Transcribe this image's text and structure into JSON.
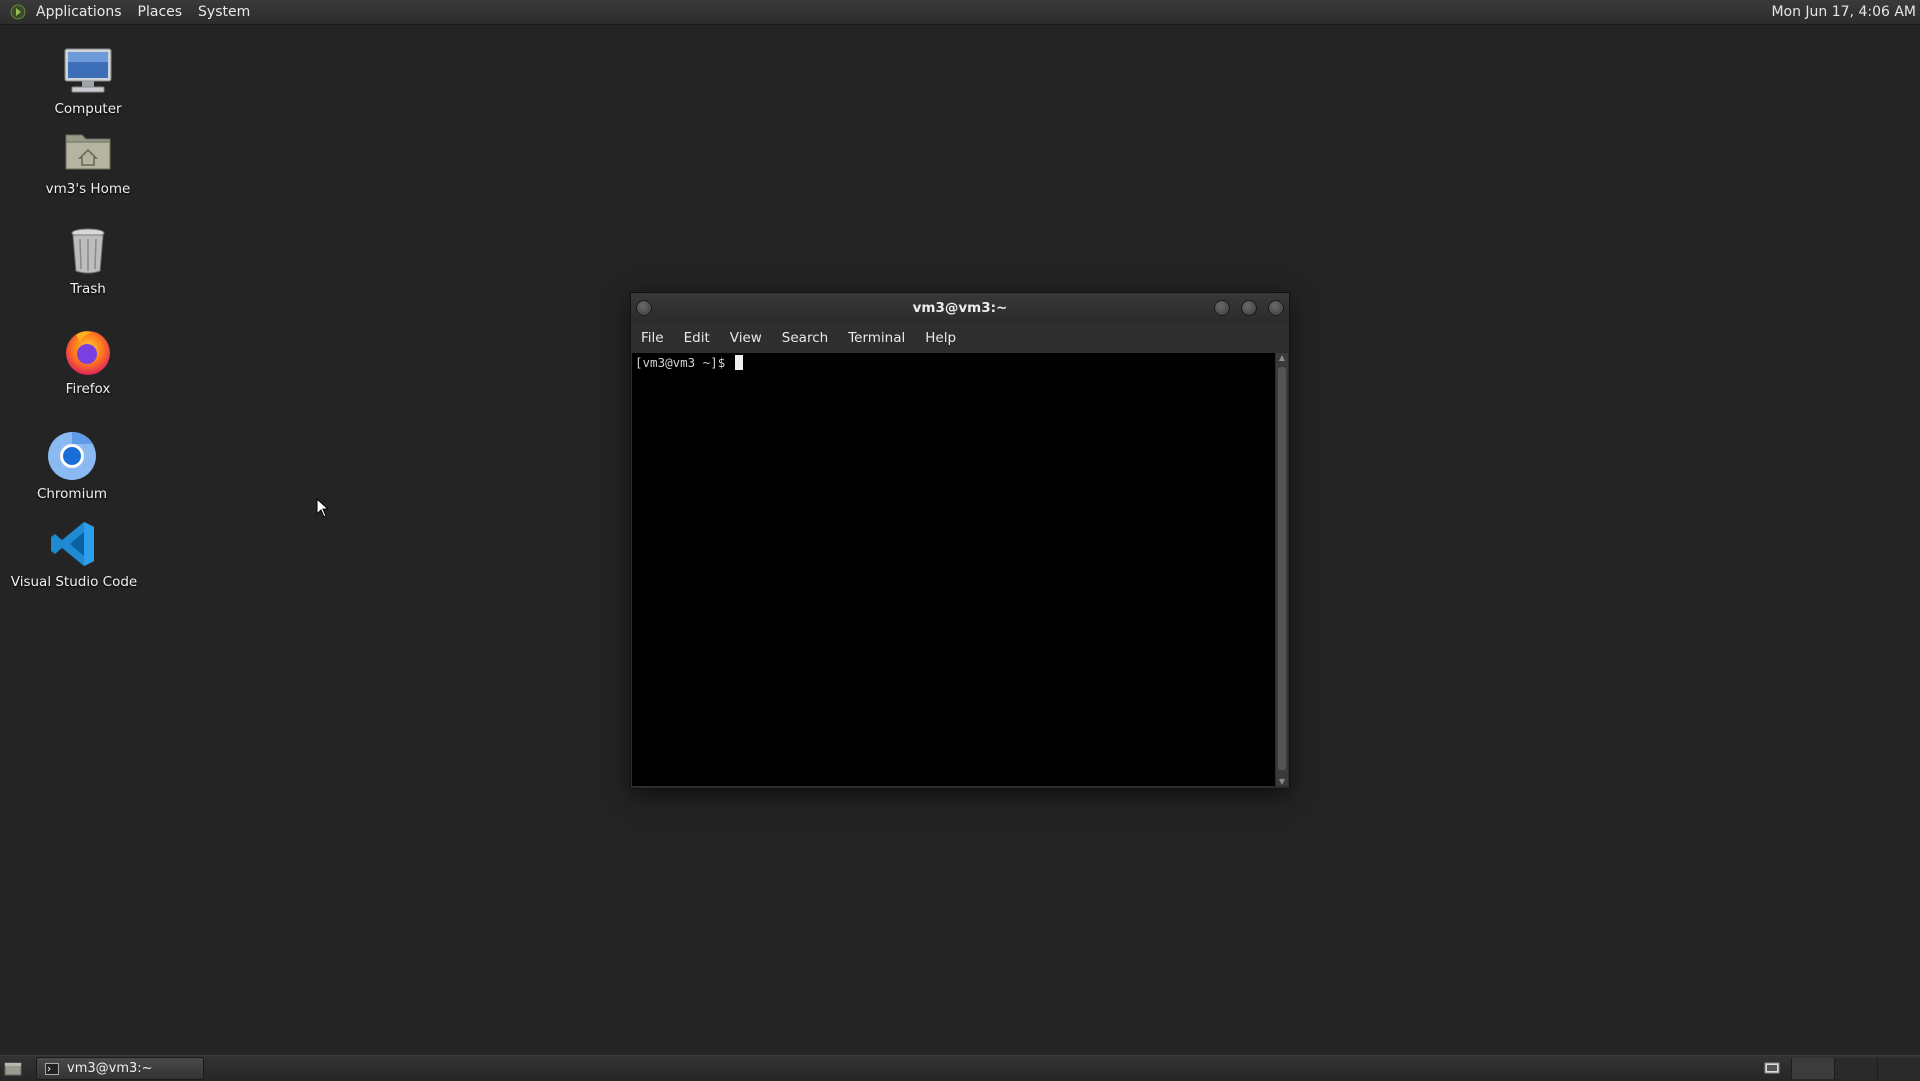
{
  "top_panel": {
    "menus": [
      "Applications",
      "Places",
      "System"
    ],
    "clock": "Mon Jun 17,  4:06 AM"
  },
  "desktop": {
    "icons": [
      {
        "label": "Computer",
        "icon": "computer-icon"
      },
      {
        "label": "vm3's Home",
        "icon": "home-folder-icon"
      },
      {
        "label": "Trash",
        "icon": "trash-icon"
      },
      {
        "label": "Firefox",
        "icon": "firefox-icon"
      },
      {
        "label": "Chromium",
        "icon": "chromium-icon"
      },
      {
        "label": "Visual Studio Code",
        "icon": "vscode-icon"
      }
    ]
  },
  "terminal": {
    "title": "vm3@vm3:~",
    "menus": [
      "File",
      "Edit",
      "View",
      "Search",
      "Terminal",
      "Help"
    ],
    "prompt": "[vm3@vm3 ~]$ "
  },
  "bottom_panel": {
    "task_label": "vm3@vm3:~"
  },
  "colors": {
    "desktop_bg": "#242424",
    "terminal_bg": "#000000",
    "panel_bg": "#2c2c2c"
  }
}
